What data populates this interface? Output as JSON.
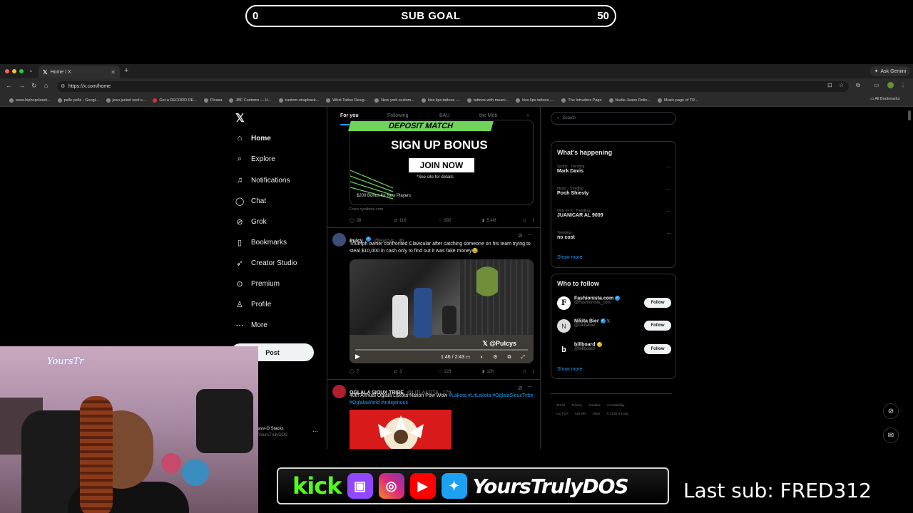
{
  "overlay": {
    "sub_goal": {
      "start": "0",
      "label": "SUB GOAL",
      "end": "50"
    },
    "banner": {
      "kick": "kick",
      "handle": "YoursTrulyDOS"
    },
    "last_sub": "Last sub: FRED312",
    "webcam_sign": "YoursTr"
  },
  "browser": {
    "tab_title": "Home / X",
    "ask_gemini": "Ask Gemini",
    "url": "https://x.com/home",
    "bookmarks": [
      "www.hiphopcloset...",
      "pelle pelle - Googl...",
      "jean jacket vest s...",
      "Get a RECORD DE...",
      "Picasa",
      "JBF Customs — H...",
      "custom strapback...",
      "Wrist Tattoo Desig...",
      "New york custom...",
      "kiss lips tattoos -...",
      "tattoos with meani...",
      "kiss lips tattoos -...",
      "The Intruders Page",
      "Nudie Jeans Onlin...",
      "Music page of TR..."
    ],
    "all_bookmarks": "All Bookmarks"
  },
  "nav": {
    "items": [
      {
        "label": "Home",
        "icon": "home-icon"
      },
      {
        "label": "Explore",
        "icon": "search-icon"
      },
      {
        "label": "Notifications",
        "icon": "bell-icon"
      },
      {
        "label": "Chat",
        "icon": "chat-icon"
      },
      {
        "label": "Grok",
        "icon": "grok-icon"
      },
      {
        "label": "Bookmarks",
        "icon": "bookmark-icon"
      },
      {
        "label": "Creator Studio",
        "icon": "rocket-icon"
      },
      {
        "label": "Premium",
        "icon": "premium-icon"
      },
      {
        "label": "Profile",
        "icon": "profile-icon"
      },
      {
        "label": "More",
        "icon": "more-icon"
      }
    ],
    "post": "Post",
    "account_name": "avv-O Stacks",
    "account_handle": "YoursTrulyDOS"
  },
  "feed": {
    "tabs": [
      "For you",
      "Following",
      "BAU",
      "the Mob"
    ],
    "ad": {
      "banner": "DEPOSIT MATCH",
      "headline": "SIGN UP BONUS",
      "cta": "JOIN NOW",
      "note": "*See site for details",
      "bonus": "$200 Bonus for New Players",
      "source": "From nyrabets.com",
      "stats": {
        "replies": "38",
        "reposts": "116",
        "likes": "392",
        "views": "5.4M"
      }
    },
    "tweet1": {
      "name": "Pulcy",
      "handle": "@Pulcys · 3h",
      "text": "Triumph owner confronted Clavicular after catching someone on his team trying to steal $10,000 in cash only to find out it was fake money😂",
      "video_time": "1:46 / 2:43",
      "watermark": "@Pulcys",
      "stats": {
        "replies": "7",
        "reposts": "3",
        "likes": "129",
        "views": "12K"
      }
    },
    "tweet2": {
      "name": "OGLALA SIOUX TRIBE",
      "handle": "@LITLAKOTA · 17h",
      "text_plain": "40th Annual Oglala Lakota Nation Pow Wow ",
      "text_tags": "#Lakota #LitLakota #OglalaSiouxTribe #OglalaWorld #indigenous"
    }
  },
  "right": {
    "search_placeholder": "Search",
    "whats_happening": "What's happening",
    "trends": [
      {
        "meta": "Sports · Trending",
        "name": "Mark Davis"
      },
      {
        "meta": "Music · Trending",
        "name": "Pooh Shiesty"
      },
      {
        "meta": "Only on X · Trending",
        "name": "JUANICAR AL 9009"
      },
      {
        "meta": "Trending",
        "name": "no cost"
      }
    ],
    "show_more": "Show more",
    "who_to_follow": "Who to follow",
    "follow_suggestions": [
      {
        "name": "Fashionista.com",
        "handle": "@Fashionista_com",
        "initial": "F"
      },
      {
        "name": "Nikita Bier",
        "handle": "@nikitabier",
        "initial": "N"
      },
      {
        "name": "billboard",
        "handle": "@billboard",
        "initial": "b"
      }
    ],
    "follow_label": "Follow",
    "footer": [
      "Terms",
      "Privacy",
      "Cookies",
      "Accessibility",
      "US TOA",
      "Ads info",
      "More",
      "© 2026 X Corp."
    ]
  },
  "colors": {
    "accent": "#1d9bf0",
    "kick": "#53fc18",
    "twitch": "#9146ff",
    "youtube": "#ff0000",
    "twitter": "#1da1f2"
  }
}
